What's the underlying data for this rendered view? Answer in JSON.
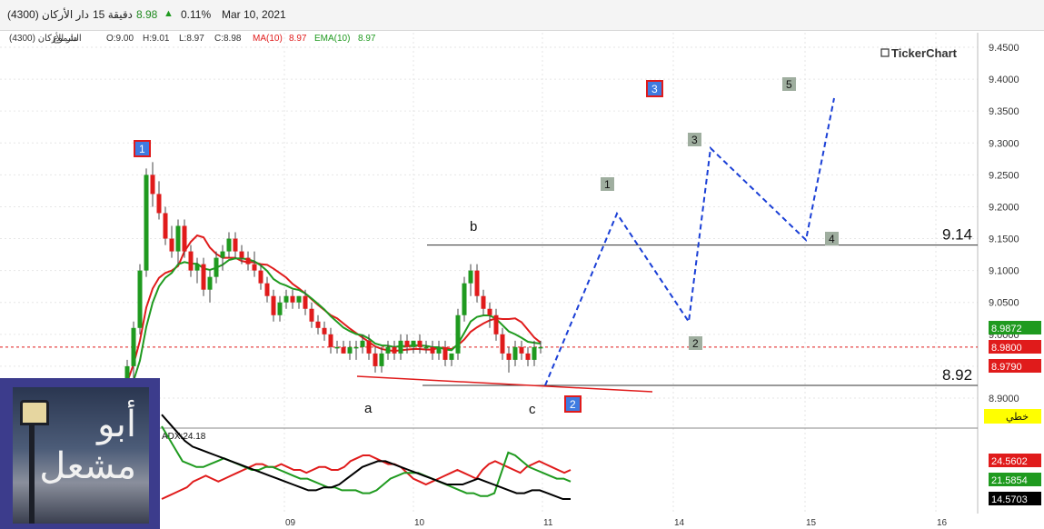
{
  "header": {
    "symbol_info": "دار الأركان (4300)",
    "interval": "15 دقيقة",
    "last_price": "8.98",
    "change_pct": "0.11%",
    "date": "Mar 10, 2021"
  },
  "ohlc_bar": {
    "symbol": "دار الأركان (4300)",
    "chart_type": "الشموع",
    "open": "O:9.00",
    "high": "H:9.01",
    "low": "L:8.97",
    "close": "C:8.98",
    "ma_label": "MA(10)",
    "ma_value": "8.97",
    "ema_label": "EMA(10)",
    "ema_value": "8.97"
  },
  "brand": "TickerChart",
  "colors": {
    "bull": "#1f9a1f",
    "bear": "#e01b1b",
    "projection": "#1a3fd6",
    "ma": "#e01b1b",
    "ema": "#1f9a1f",
    "grid": "#e6e6e6"
  },
  "axis": {
    "y_ticks": [
      "9.4500",
      "9.4000",
      "9.3500",
      "9.3000",
      "9.2500",
      "9.2000",
      "9.1500",
      "9.1000",
      "9.0500",
      "9.0000",
      "8.9500",
      "8.9000"
    ],
    "x_ticks": [
      "09",
      "10",
      "11",
      "14",
      "15",
      "16"
    ],
    "badge_ema": "8.9872",
    "badge_last": "8.9800",
    "badge_ma": "8.9790",
    "trendline_label": "خطي"
  },
  "levels": {
    "resistance": "9.14",
    "support": "8.92"
  },
  "wave_labels": {
    "a": "a",
    "b": "b",
    "c": "c",
    "w1_red": "1",
    "w2_red": "2",
    "w3_red": "3",
    "w1": "1",
    "w2": "2",
    "w3": "3",
    "w4": "4",
    "w5": "5"
  },
  "adx": {
    "label": "ADX:24.18",
    "badge_red": "24.5602",
    "badge_green": "21.5854",
    "badge_black": "14.5703"
  },
  "avatar": {
    "line1": "أبو",
    "line2": "مشعل"
  },
  "chart_data": {
    "type": "candlestick",
    "ylim": [
      8.88,
      9.46
    ],
    "candles": [
      [
        8.84,
        8.9,
        8.82,
        8.9
      ],
      [
        8.9,
        8.96,
        8.88,
        8.95
      ],
      [
        8.95,
        9.02,
        8.93,
        9.01
      ],
      [
        9.01,
        9.11,
        9.0,
        9.1
      ],
      [
        9.1,
        9.26,
        9.09,
        9.25
      ],
      [
        9.25,
        9.27,
        9.2,
        9.22
      ],
      [
        9.22,
        9.24,
        9.18,
        9.19
      ],
      [
        9.19,
        9.2,
        9.14,
        9.15
      ],
      [
        9.15,
        9.17,
        9.12,
        9.13
      ],
      [
        9.13,
        9.18,
        9.11,
        9.17
      ],
      [
        9.17,
        9.18,
        9.12,
        9.13
      ],
      [
        9.13,
        9.14,
        9.09,
        9.1
      ],
      [
        9.1,
        9.12,
        9.08,
        9.11
      ],
      [
        9.11,
        9.12,
        9.06,
        9.07
      ],
      [
        9.07,
        9.1,
        9.05,
        9.09
      ],
      [
        9.09,
        9.13,
        9.08,
        9.12
      ],
      [
        9.12,
        9.14,
        9.1,
        9.13
      ],
      [
        9.13,
        9.16,
        9.12,
        9.15
      ],
      [
        9.15,
        9.16,
        9.12,
        9.13
      ],
      [
        9.13,
        9.14,
        9.11,
        9.12
      ],
      [
        9.12,
        9.13,
        9.1,
        9.11
      ],
      [
        9.11,
        9.13,
        9.09,
        9.1
      ],
      [
        9.1,
        9.11,
        9.07,
        9.08
      ],
      [
        9.08,
        9.09,
        9.05,
        9.06
      ],
      [
        9.06,
        9.07,
        9.02,
        9.03
      ],
      [
        9.03,
        9.06,
        9.02,
        9.05
      ],
      [
        9.05,
        9.07,
        9.04,
        9.06
      ],
      [
        9.06,
        9.07,
        9.04,
        9.05
      ],
      [
        9.05,
        9.06,
        9.04,
        9.06
      ],
      [
        9.06,
        9.07,
        9.03,
        9.04
      ],
      [
        9.04,
        9.05,
        9.01,
        9.02
      ],
      [
        9.02,
        9.03,
        9.0,
        9.01
      ],
      [
        9.01,
        9.02,
        8.99,
        9.0
      ],
      [
        9.0,
        9.01,
        8.97,
        8.98
      ],
      [
        8.98,
        8.99,
        8.97,
        8.98
      ],
      [
        8.98,
        8.99,
        8.97,
        8.97
      ],
      [
        8.97,
        8.99,
        8.96,
        8.98
      ],
      [
        8.98,
        8.99,
        8.96,
        8.98
      ],
      [
        8.98,
        9.0,
        8.97,
        8.99
      ],
      [
        8.99,
        9.0,
        8.96,
        8.97
      ],
      [
        8.97,
        8.98,
        8.94,
        8.95
      ],
      [
        8.95,
        8.98,
        8.94,
        8.97
      ],
      [
        8.97,
        8.99,
        8.96,
        8.98
      ],
      [
        8.98,
        8.99,
        8.96,
        8.97
      ],
      [
        8.97,
        9.0,
        8.96,
        8.99
      ],
      [
        8.99,
        9.0,
        8.97,
        8.98
      ],
      [
        8.98,
        8.99,
        8.97,
        8.99
      ],
      [
        8.99,
        9.0,
        8.97,
        8.98
      ],
      [
        8.98,
        8.99,
        8.97,
        8.98
      ],
      [
        8.98,
        8.99,
        8.96,
        8.97
      ],
      [
        8.97,
        8.99,
        8.96,
        8.98
      ],
      [
        8.98,
        8.99,
        8.95,
        8.96
      ],
      [
        8.96,
        8.97,
        8.95,
        8.97
      ],
      [
        8.97,
        9.04,
        8.96,
        9.03
      ],
      [
        9.03,
        9.09,
        9.02,
        9.08
      ],
      [
        9.08,
        9.11,
        9.06,
        9.1
      ],
      [
        9.1,
        9.11,
        9.05,
        9.06
      ],
      [
        9.06,
        9.07,
        9.03,
        9.04
      ],
      [
        9.04,
        9.05,
        9.01,
        9.03
      ],
      [
        9.03,
        9.04,
        8.99,
        9.0
      ],
      [
        9.0,
        9.01,
        8.96,
        8.97
      ],
      [
        8.97,
        8.98,
        8.94,
        8.96
      ],
      [
        8.96,
        8.99,
        8.95,
        8.98
      ],
      [
        8.98,
        8.99,
        8.96,
        8.97
      ],
      [
        8.97,
        8.98,
        8.95,
        8.96
      ],
      [
        8.96,
        8.99,
        8.95,
        8.98
      ],
      [
        8.98,
        8.99,
        8.97,
        8.98
      ]
    ],
    "projection_path": [
      [
        8.92,
        "c"
      ],
      [
        9.19,
        "1"
      ],
      [
        9.02,
        "2"
      ],
      [
        9.29,
        "3"
      ],
      [
        9.15,
        "4"
      ],
      [
        9.37,
        "5"
      ]
    ]
  }
}
